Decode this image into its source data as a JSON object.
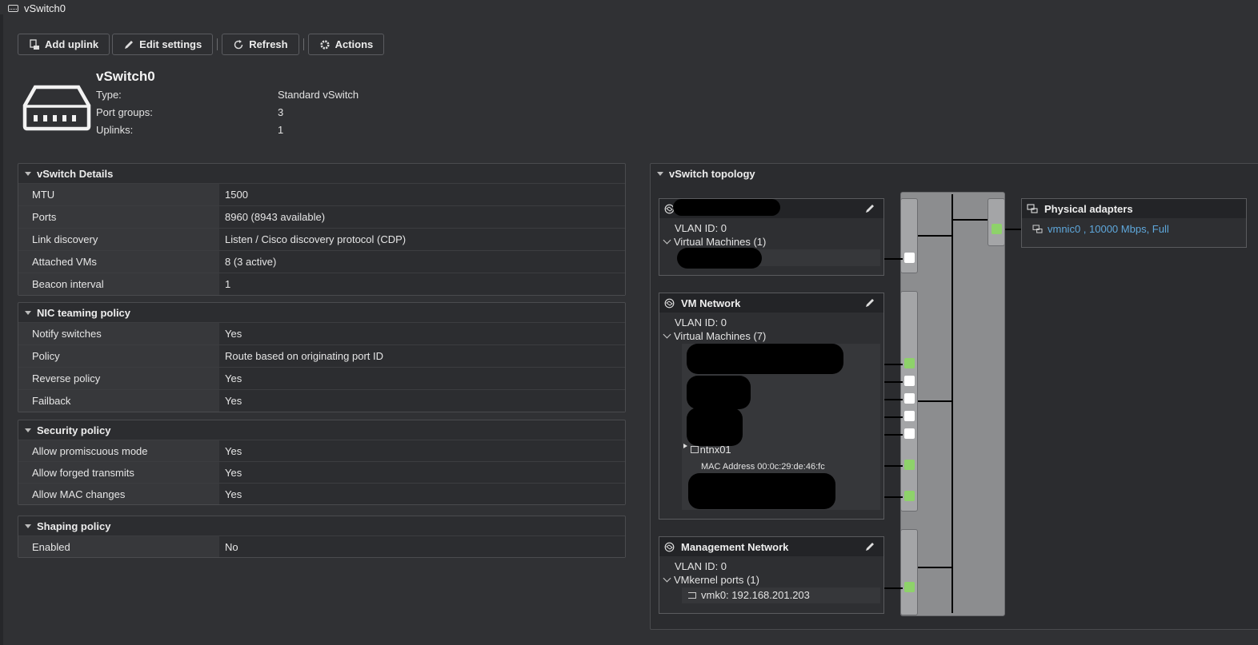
{
  "window": {
    "title": "vSwitch0"
  },
  "toolbar": {
    "add_uplink": "Add uplink",
    "edit_settings": "Edit settings",
    "refresh": "Refresh",
    "actions": "Actions"
  },
  "summary": {
    "name": "vSwitch0",
    "type_label": "Type:",
    "type_value": "Standard vSwitch",
    "portgroups_label": "Port groups:",
    "portgroups_value": "3",
    "uplinks_label": "Uplinks:",
    "uplinks_value": "1"
  },
  "details": {
    "title": "vSwitch Details",
    "rows": [
      {
        "k": "MTU",
        "v": "1500"
      },
      {
        "k": "Ports",
        "v": "8960 (8943 available)"
      },
      {
        "k": "Link discovery",
        "v": "Listen / Cisco discovery protocol (CDP)"
      },
      {
        "k": "Attached VMs",
        "v": "8 (3 active)"
      },
      {
        "k": "Beacon interval",
        "v": "1"
      }
    ]
  },
  "nic": {
    "title": "NIC teaming policy",
    "rows": [
      {
        "k": "Notify switches",
        "v": "Yes"
      },
      {
        "k": "Policy",
        "v": "Route based on originating port ID"
      },
      {
        "k": "Reverse policy",
        "v": "Yes"
      },
      {
        "k": "Failback",
        "v": "Yes"
      }
    ]
  },
  "security": {
    "title": "Security policy",
    "rows": [
      {
        "k": "Allow promiscuous mode",
        "v": "Yes"
      },
      {
        "k": "Allow forged transmits",
        "v": "Yes"
      },
      {
        "k": "Allow MAC changes",
        "v": "Yes"
      }
    ]
  },
  "shaping": {
    "title": "Shaping policy",
    "rows": [
      {
        "k": "Enabled",
        "v": "No"
      }
    ]
  },
  "topology": {
    "title": "vSwitch topology",
    "pg1": {
      "vlan": "VLAN ID: 0",
      "vms": "Virtual Machines (1)"
    },
    "pg2": {
      "name": "VM Network",
      "vlan": "VLAN ID: 0",
      "vms": "Virtual Machines (7)",
      "vm_name": "ntnx01",
      "mac": "MAC Address 00:0c:29:de:46:fc"
    },
    "pg3": {
      "name": "Management Network",
      "vlan": "VLAN ID: 0",
      "ports": "VMkernel ports (1)",
      "vmk": "vmk0: 192.168.201.203"
    },
    "physical": {
      "title": "Physical adapters",
      "nic": "vmnic0 , 10000 Mbps, Full"
    }
  },
  "colors": {
    "background": "#303134",
    "port_active": "#8ed26a",
    "port_inactive": "#ffffff",
    "link": "#5fa8dc"
  }
}
